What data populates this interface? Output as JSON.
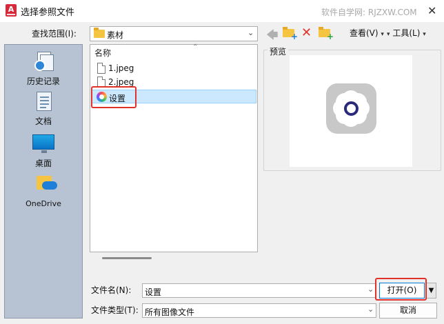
{
  "window": {
    "title": "选择参照文件",
    "app_icon_letter": "A",
    "watermark": "软件自学网: RJZXW.COM",
    "close_glyph": "✕"
  },
  "toolbar": {
    "look_in_label": "查找范围(I):",
    "look_in_value": "素材",
    "views_label": "查看(V)",
    "tools_label": "工具(L)",
    "dropdown_dot": "▾"
  },
  "places": [
    {
      "label": "历史记录",
      "icon": "history-icon"
    },
    {
      "label": "文档",
      "icon": "documents-icon"
    },
    {
      "label": "桌面",
      "icon": "desktop-icon"
    },
    {
      "label": "OneDrive",
      "icon": "onedrive-icon"
    }
  ],
  "file_list": {
    "column_header": "名称",
    "items": [
      {
        "name": "1.jpeg",
        "icon": "image-file-icon",
        "selected": false
      },
      {
        "name": "2.jpeg",
        "icon": "image-file-icon",
        "selected": false
      },
      {
        "name": "设置",
        "icon": "settings-app-icon",
        "selected": true
      }
    ]
  },
  "preview": {
    "label": "预览",
    "image": "settings-gear-icon"
  },
  "footer": {
    "filename_label": "文件名(N):",
    "filename_value": "设置",
    "filetype_label": "文件类型(T):",
    "filetype_value": "所有图像文件",
    "open_button": "打开(O)",
    "cancel_button": "取消"
  },
  "colors": {
    "highlight_box": "#e0322a",
    "selected_row": "#cce8ff",
    "places_bg": "#b7c3d2"
  }
}
